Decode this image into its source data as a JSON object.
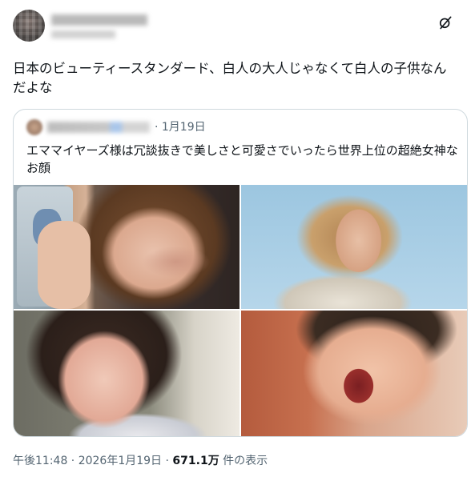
{
  "post": {
    "text_line1": "日本のビューティースタンダード、白人の大人じゃなくて白人の子供なん",
    "text_line2": "だよな"
  },
  "quote": {
    "date": "· 1月19日",
    "text_line1": "エママイヤーズ様は冗談抜きで美しさと可愛さでいったら世界上位の超絶女神な",
    "text_line2": "お顔"
  },
  "footer": {
    "time": "午後11:48 · 2026年1月19日 · ",
    "views_count": "671.1万",
    "views_label": " 件の表示"
  },
  "icons": {
    "grok": "grok-icon"
  }
}
